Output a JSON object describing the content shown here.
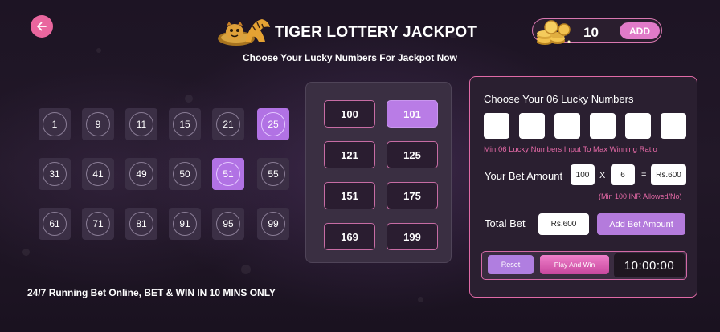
{
  "header": {
    "title": "TIGER LOTTERY JACKPOT",
    "subtitle": "Choose Your Lucky Numbers For Jackpot Now"
  },
  "wallet": {
    "balance": "10",
    "add_label": "ADD"
  },
  "number_grid": [
    [
      {
        "n": "1",
        "selected": false
      },
      {
        "n": "9",
        "selected": false
      },
      {
        "n": "11",
        "selected": false
      },
      {
        "n": "15",
        "selected": false
      },
      {
        "n": "21",
        "selected": false
      },
      {
        "n": "25",
        "selected": true
      }
    ],
    [
      {
        "n": "31",
        "selected": false
      },
      {
        "n": "41",
        "selected": false
      },
      {
        "n": "49",
        "selected": false
      },
      {
        "n": "50",
        "selected": false
      },
      {
        "n": "51",
        "selected": true
      },
      {
        "n": "55",
        "selected": false
      }
    ],
    [
      {
        "n": "61",
        "selected": false
      },
      {
        "n": "71",
        "selected": false
      },
      {
        "n": "81",
        "selected": false
      },
      {
        "n": "91",
        "selected": false
      },
      {
        "n": "95",
        "selected": false
      },
      {
        "n": "99",
        "selected": false
      }
    ]
  ],
  "big_numbers": [
    [
      {
        "n": "100",
        "selected": false
      },
      {
        "n": "101",
        "selected": true
      }
    ],
    [
      {
        "n": "121",
        "selected": false
      },
      {
        "n": "125",
        "selected": false
      }
    ],
    [
      {
        "n": "151",
        "selected": false
      },
      {
        "n": "175",
        "selected": false
      }
    ],
    [
      {
        "n": "169",
        "selected": false
      },
      {
        "n": "199",
        "selected": false
      }
    ]
  ],
  "bet_panel": {
    "title": "Choose Your 06 Lucky Numbers",
    "lucky_inputs": [
      "",
      "",
      "",
      "",
      "",
      ""
    ],
    "lucky_hint": "Min 06 Lucky Numbers Input To Max Winning Ratio",
    "bet_amount_label": "Your Bet Amount",
    "bet_value": "100",
    "multiply_symbol": "X",
    "multiplier": "6",
    "equals_symbol": "=",
    "bet_result": "Rs.600",
    "bet_hint": "(Min 100 INR Allowed/No)",
    "total_label": "Total Bet",
    "total_value": "Rs.600",
    "add_bet_label": "Add Bet Amount"
  },
  "actions": {
    "reset_label": "Reset",
    "play_label": "Play And Win",
    "timer": "10:00:00"
  },
  "footer": {
    "text": "24/7 Running Bet Online, BET & WIN IN 10 MINS ONLY"
  },
  "colors": {
    "accent_pink": "#e9669e",
    "accent_purple": "#b172e4",
    "border_pink": "#d977b0",
    "background": "#1d1424"
  },
  "icons": {
    "back": "arrow-left-icon",
    "logo": "tiger-logo-icon",
    "coins": "gold-coins-icon"
  }
}
